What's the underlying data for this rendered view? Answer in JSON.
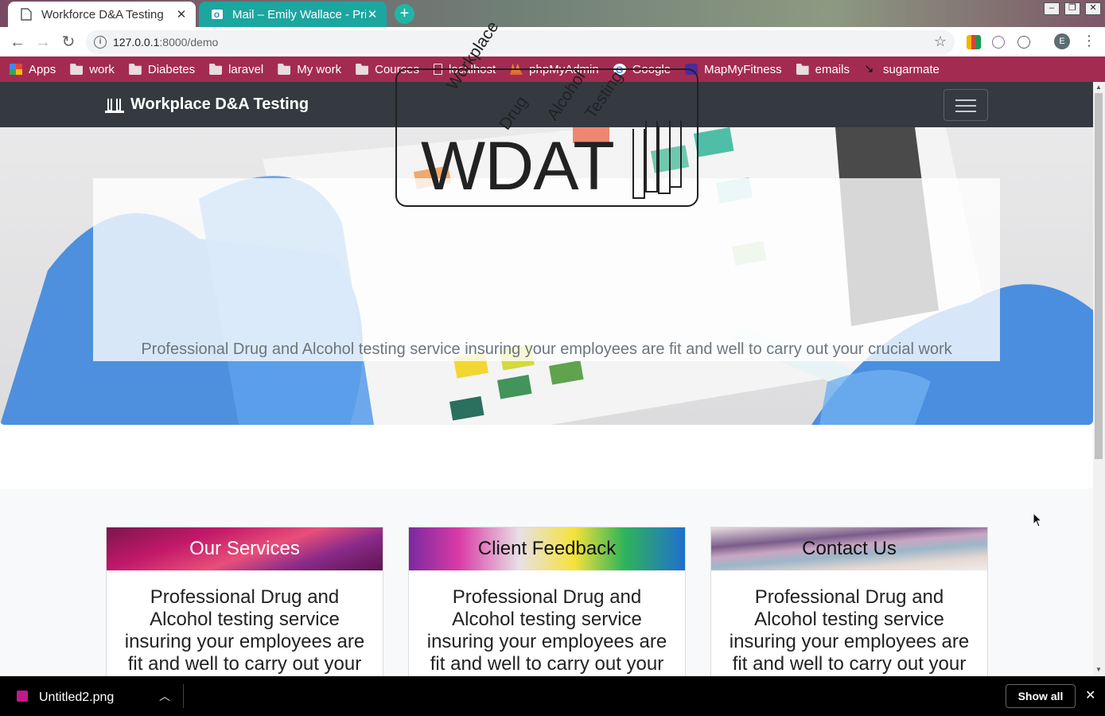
{
  "browser": {
    "tabs": [
      {
        "title": "Workforce D&A Testing",
        "active": true
      },
      {
        "title": "Mail – Emily Wallace - Pric",
        "active": false
      }
    ],
    "url_host": "127.0.0.1",
    "url_rest": ":8000/demo",
    "bookmarks": [
      "Apps",
      "work",
      "Diabetes",
      "laravel",
      "My work",
      "Courses",
      "localhost",
      "phpMyAdmin",
      "Google",
      "MapMyFitness",
      "emails",
      "sugarmate"
    ],
    "profile_initial": "E"
  },
  "site": {
    "brand": "Workplace D&A Testing",
    "logo": {
      "main": "WDAT",
      "words": [
        "Workplace",
        "Drug",
        "Alcohol",
        "Testing"
      ]
    },
    "tagline": "Professional Drug and Alcohol testing service insuring your employees are fit and well to carry out your crucial work",
    "cards": [
      {
        "title": "Our Services",
        "body": "Professional Drug and Alcohol testing service insuring your employees are fit and well to carry out your"
      },
      {
        "title": "Client Feedback",
        "body": "Professional Drug and Alcohol testing service insuring your employees are fit and well to carry out your"
      },
      {
        "title": "Contact Us",
        "body": "Professional Drug and Alcohol testing service insuring your employees are fit and well to carry out your"
      }
    ]
  },
  "downloads": {
    "file": "Untitled2.png",
    "show_all": "Show all"
  },
  "colors": {
    "bookmarks_bar": "#a32b52",
    "site_nav": "#343a40",
    "active_tab_other": "#1ca6a0"
  }
}
